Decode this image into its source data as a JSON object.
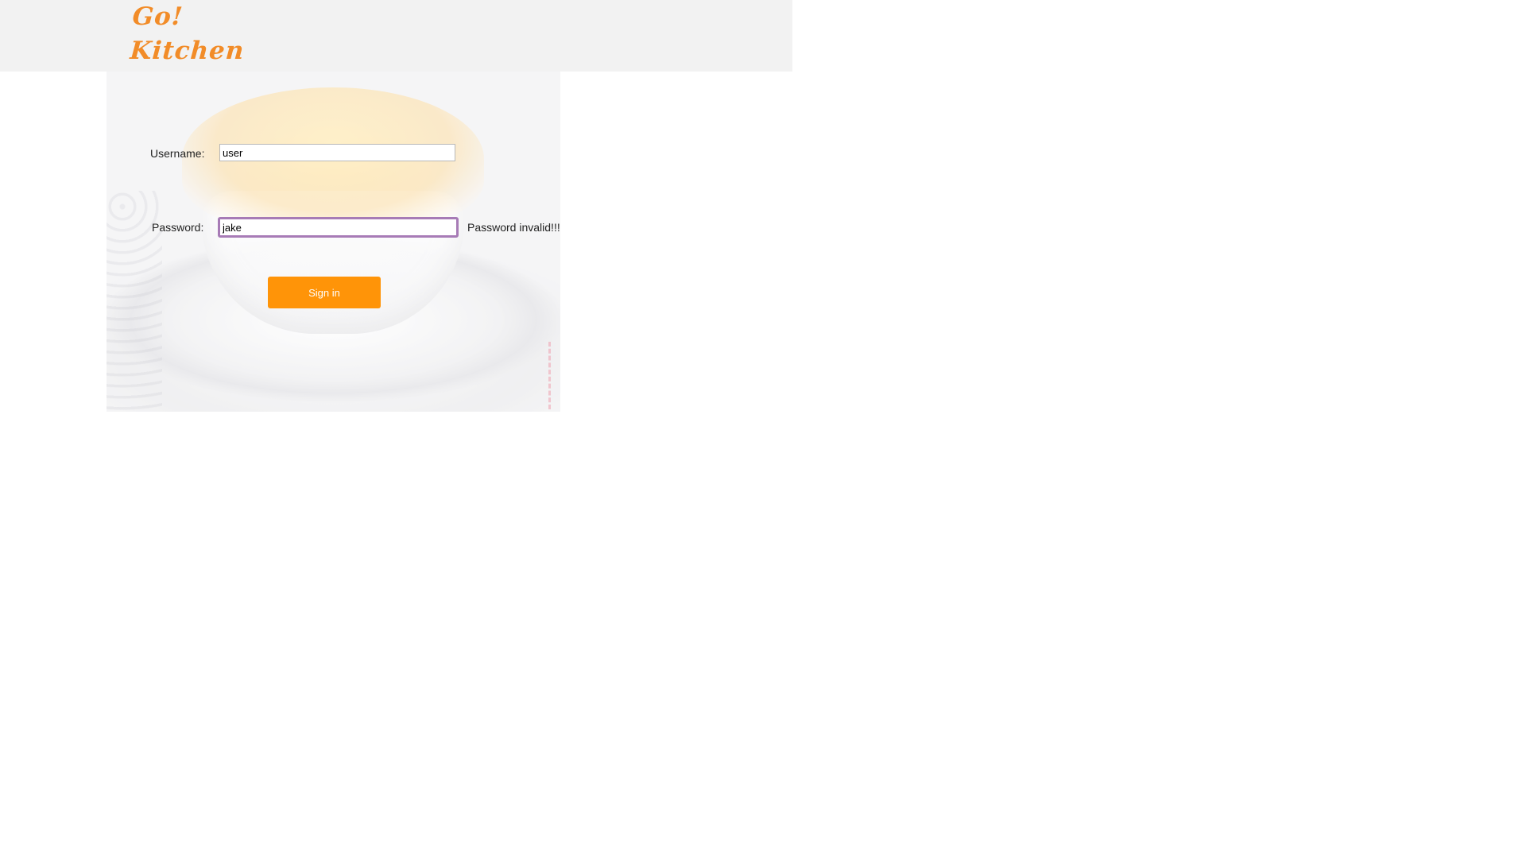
{
  "header": {
    "logo_line1": "Go!",
    "logo_line2": "Kitchen",
    "brand_color": "#f28c28"
  },
  "login_form": {
    "username_label": "Username:",
    "username_value": "user",
    "password_label": "Password:",
    "password_value": "jake",
    "password_error": "Password invalid!!!",
    "signin_label": "Sign in",
    "button_color": "#ff9408",
    "focus_border_color": "#a77bb6"
  },
  "hero": {
    "image": "souffle-in-white-ramekin"
  }
}
